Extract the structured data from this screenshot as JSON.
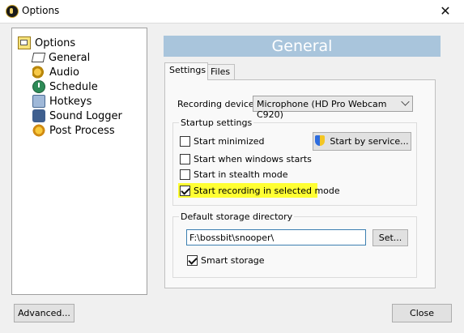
{
  "window": {
    "title": "Options",
    "close_glyph": "✕"
  },
  "tree": {
    "root": {
      "label": "Options",
      "icon": "options-icon"
    },
    "items": [
      {
        "label": "General",
        "icon": "general-icon"
      },
      {
        "label": "Audio",
        "icon": "audio-icon"
      },
      {
        "label": "Schedule",
        "icon": "schedule-icon"
      },
      {
        "label": "Hotkeys",
        "icon": "hotkeys-icon"
      },
      {
        "label": "Sound Logger",
        "icon": "sound-logger-icon"
      },
      {
        "label": "Post Process",
        "icon": "post-process-icon"
      }
    ]
  },
  "panel": {
    "header": "General",
    "tabs": [
      {
        "label": "Settings",
        "active": true
      },
      {
        "label": "Files",
        "active": false
      }
    ],
    "recording_device": {
      "label": "Recording device",
      "value": "Microphone (HD Pro Webcam C920)"
    },
    "startup": {
      "title": "Startup settings",
      "service_button": "Start by service...",
      "options": [
        {
          "label": "Start minimized",
          "checked": false
        },
        {
          "label": "Start when windows starts",
          "checked": false
        },
        {
          "label": "Start in stealth mode",
          "checked": false
        },
        {
          "label": "Start recording in selected mode",
          "checked": true,
          "highlighted": true
        }
      ]
    },
    "storage": {
      "title": "Default storage directory",
      "path": "F:\\bossbit\\snooper\\",
      "set_button": "Set...",
      "smart_storage": {
        "label": "Smart storage",
        "checked": true
      }
    }
  },
  "footer": {
    "advanced_button": "Advanced...",
    "close_button": "Close"
  },
  "colors": {
    "header_bg": "#a9c5dc",
    "highlight": "#ffff33",
    "focus_border": "#3c7fb1"
  }
}
